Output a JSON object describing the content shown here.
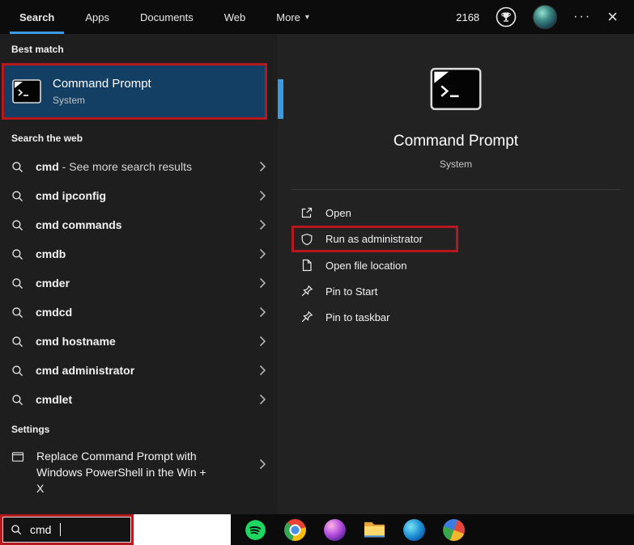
{
  "colors": {
    "accent_blue": "#3b9ae1",
    "annotation_red": "#b6181e",
    "highlight_blue": "#123f63"
  },
  "header": {
    "tabs": [
      {
        "label": "Search"
      },
      {
        "label": "Apps"
      },
      {
        "label": "Documents"
      },
      {
        "label": "Web"
      },
      {
        "label": "More"
      }
    ],
    "more_chevron": "▾",
    "rewards_points": "2168",
    "more_options_glyph": "···",
    "close_glyph": "×"
  },
  "left_panel": {
    "best_match_header": "Best match",
    "best_match": {
      "title": "Command Prompt",
      "subtitle": "System"
    },
    "search_web_header": "Search the web",
    "suggestions": [
      {
        "query": "cmd",
        "suffix": " - See more search results"
      },
      {
        "query": "cmd ipconfig",
        "suffix": ""
      },
      {
        "query": "cmd commands",
        "suffix": ""
      },
      {
        "query": "cmdb",
        "suffix": ""
      },
      {
        "query": "cmder",
        "suffix": ""
      },
      {
        "query": "cmdcd",
        "suffix": ""
      },
      {
        "query": "cmd hostname",
        "suffix": ""
      },
      {
        "query": "cmd administrator",
        "suffix": ""
      },
      {
        "query": "cmdlet",
        "suffix": ""
      }
    ],
    "settings_header": "Settings",
    "settings_item": "Replace Command Prompt with Windows PowerShell in the Win + X"
  },
  "right_panel": {
    "app_title": "Command Prompt",
    "app_subtitle": "System",
    "actions": [
      {
        "label": "Open"
      },
      {
        "label": "Run as administrator"
      },
      {
        "label": "Open file location"
      },
      {
        "label": "Pin to Start"
      },
      {
        "label": "Pin to taskbar"
      }
    ]
  },
  "taskbar": {
    "search_value": "cmd",
    "icons": [
      "spotify",
      "chrome",
      "media-app",
      "file-explorer",
      "edge",
      "colorful-app"
    ]
  }
}
